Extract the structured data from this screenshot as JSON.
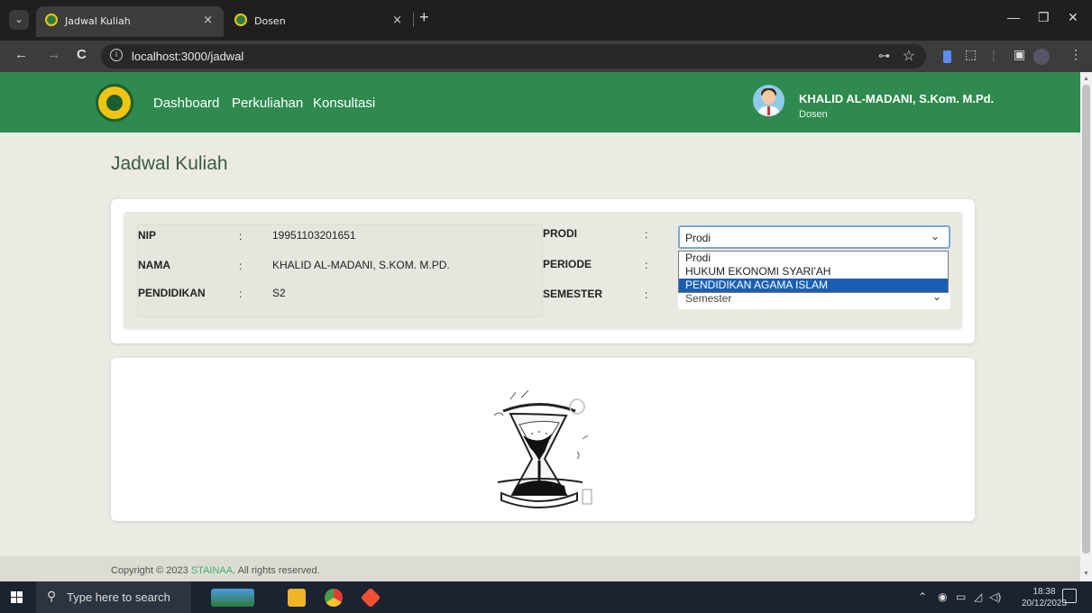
{
  "browser": {
    "tabs": [
      {
        "title": "Jadwal Kuliah",
        "close": "×"
      },
      {
        "title": "Dosen",
        "close": "×"
      }
    ],
    "new_tab": "+",
    "window_controls": {
      "minimize": "—",
      "restore": "❐",
      "close": "✕"
    },
    "nav": {
      "back": "←",
      "forward": "→",
      "reload": "C"
    },
    "address": "localhost:3000/jadwal",
    "info_icon": "i",
    "key_icon": "⊶",
    "star_icon": "☆"
  },
  "header": {
    "nav_links": [
      "Dashboard",
      "Perkuliahan",
      "Konsultasi"
    ],
    "user_name": "KHALID AL-MADANI, S.Kom. M.Pd.",
    "user_role": "Dosen"
  },
  "main": {
    "title": "Jadwal Kuliah",
    "info": {
      "nip_label": "NIP",
      "nip_value": "19951103201651",
      "nama_label": "NAMA",
      "nama_value": "KHALID AL-MADANI, S.KOM. M.PD.",
      "pendidikan_label": "PENDIDIKAN",
      "pendidikan_value": "S2",
      "colon": ":"
    },
    "filters": {
      "prodi_label": "PRODI",
      "periode_label": "PERIODE",
      "semester_label": "SEMESTER",
      "prodi_selected": "Prodi",
      "semester_selected": "Semester",
      "prodi_options": [
        "Prodi",
        "HUKUM EKONOMI SYARI'AH",
        "PENDIDIKAN AGAMA ISLAM"
      ],
      "highlighted_option": "PENDIDIKAN AGAMA ISLAM"
    }
  },
  "footer": {
    "prefix": "Copyright © 2023 ",
    "brand": "STAINAA",
    "suffix": ". All rights reserved."
  },
  "taskbar": {
    "search_placeholder": "Type here to search",
    "time": "18:38",
    "date": "20/12/2023"
  },
  "colors": {
    "header_green": "#2e8a4e",
    "title_green": "#3c5a46",
    "highlight_blue": "#1a5fb4",
    "footer_brand": "#3cb371"
  }
}
